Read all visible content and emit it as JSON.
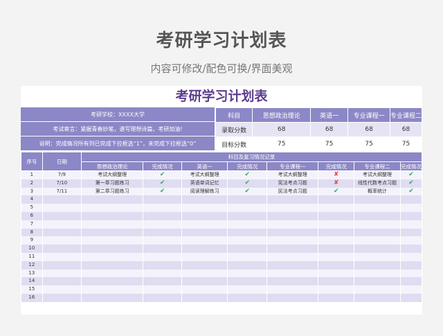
{
  "header": {
    "title": "考研学习计划表",
    "subtitle": "内容可修改/配色可换/界面美观"
  },
  "sheet": {
    "title": "考研学习计划表",
    "info": {
      "school": "考研学校：XXXX大学",
      "motto": "考试寄言：紧握青春妙笔，谱写理想诗篇，考研加油!",
      "note": "说明：完成情况所有列已完成下拉框选“1”，未完成下拉框选“0”"
    },
    "scores": {
      "headers": [
        "科目",
        "思想政治理论",
        "英语一",
        "专业课程一",
        "专业课程二"
      ],
      "rows": [
        {
          "label": "录取分数",
          "values": [
            "68",
            "68",
            "68",
            "68"
          ]
        },
        {
          "label": "目标分数",
          "values": [
            "75",
            "75",
            "75",
            "75"
          ]
        }
      ]
    },
    "records": {
      "col_no": "序号",
      "col_date": "日期",
      "group_header": "科目及复习情况记录",
      "sub_headers": [
        "思想政治理论",
        "完成情况",
        "英语一",
        "完成情况",
        "专业课程一",
        "完成情况",
        "专业课程二",
        "完成情况"
      ],
      "rows": [
        {
          "no": "1",
          "date": "7/9",
          "c1": "考试大纲整理",
          "s1": "✔",
          "c2": "考试大纲整理",
          "s2": "✔",
          "c3": "考试大纲整理",
          "s3": "✘",
          "c4": "考试大纲整理",
          "s4": "✔"
        },
        {
          "no": "2",
          "date": "7/10",
          "c1": "第一章习题练习",
          "s1": "✔",
          "c2": "英语单词记忆",
          "s2": "✔",
          "c3": "宪法考点习题",
          "s3": "✘",
          "c4": "线性代数考点习题",
          "s4": "✔"
        },
        {
          "no": "3",
          "date": "7/11",
          "c1": "第二章习题练习",
          "s1": "✔",
          "c2": "阅读理解练习",
          "s2": "✔",
          "c3": "民法考点习题",
          "s3": "✔",
          "c4": "概率统计",
          "s4": "✔"
        },
        {
          "no": "4"
        },
        {
          "no": "5"
        },
        {
          "no": "6"
        },
        {
          "no": "7"
        },
        {
          "no": "8"
        },
        {
          "no": "9"
        },
        {
          "no": "10"
        },
        {
          "no": "11"
        },
        {
          "no": "12"
        },
        {
          "no": "13"
        },
        {
          "no": "14"
        },
        {
          "no": "15"
        },
        {
          "no": "16"
        }
      ]
    }
  },
  "colors": {
    "accent": "#8c87c6",
    "title": "#5c3d8e",
    "ok": "#3aa56a",
    "no": "#e0443e"
  }
}
